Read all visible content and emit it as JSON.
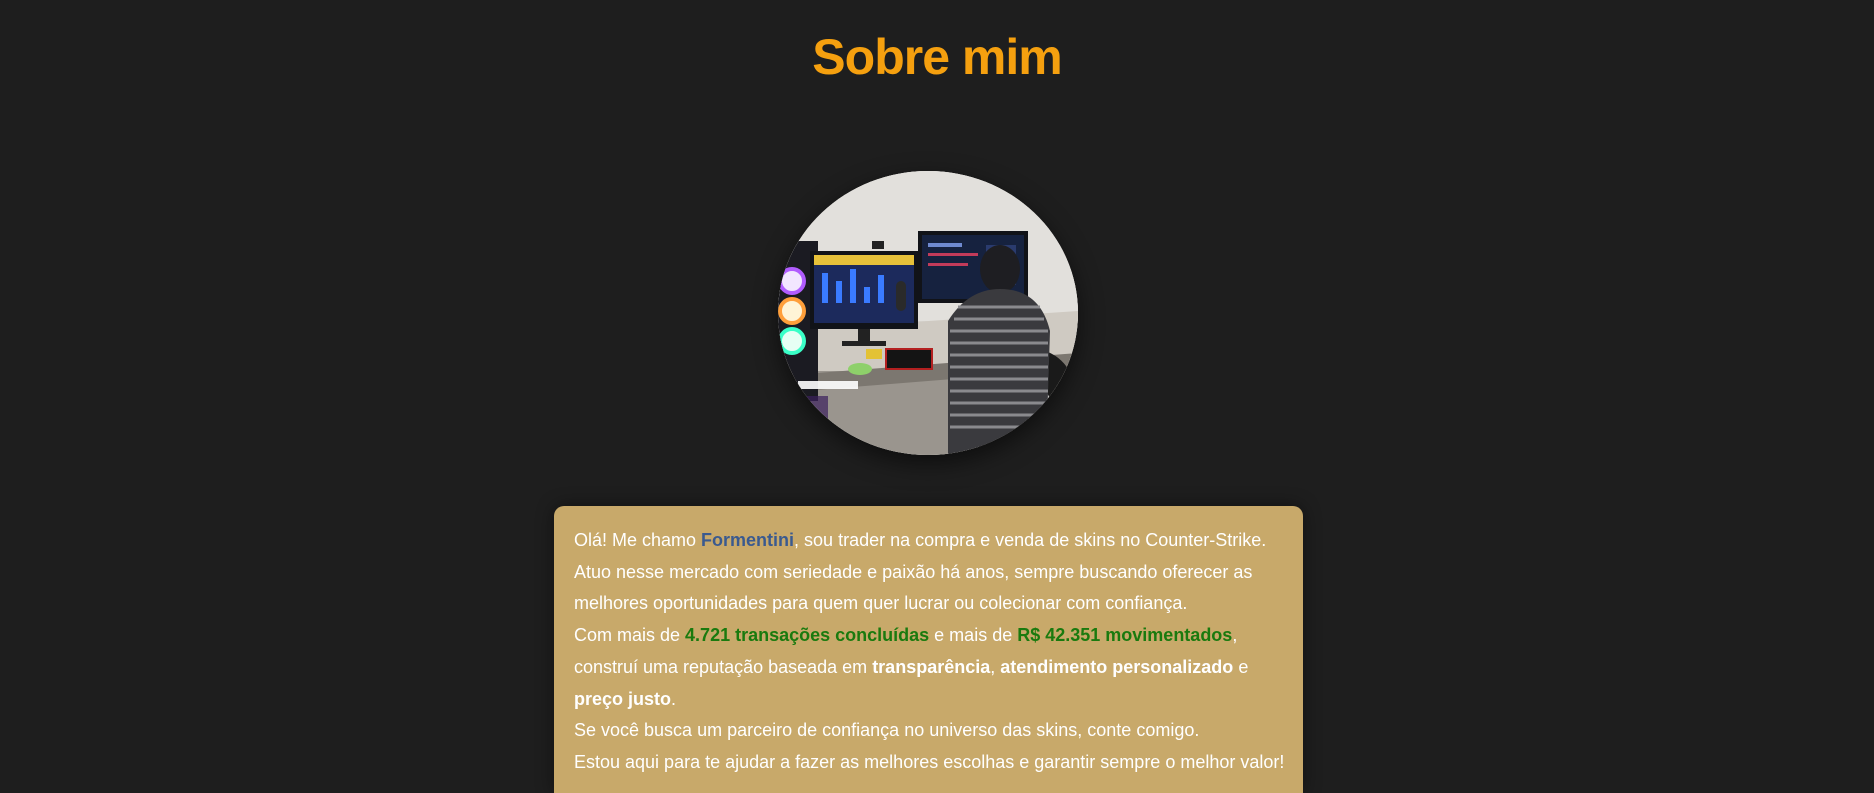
{
  "header": {
    "title": "Sobre mim"
  },
  "colors": {
    "background": "#1e1e1e",
    "title": "#f5a00f",
    "card": "#c8a96a",
    "name_highlight": "#3a5a8f",
    "stat_highlight": "#1a7a0e",
    "text": "#ffffff"
  },
  "about": {
    "photo_icon": "profile-photo",
    "line1_before": "Olá! Me chamo ",
    "name": "Formentini",
    "line1_after": ", sou trader na compra e venda de skins no Counter-Strike.",
    "line2": "Atuo nesse mercado com seriedade e paixão há anos, sempre buscando oferecer as",
    "line3": "melhores oportunidades para quem quer lucrar ou colecionar com confiança.",
    "line4_before": "Com mais de ",
    "transactions": "4.721 transações concluídas",
    "line4_middle": " e mais de ",
    "amount": "R$ 42.351 movimentados",
    "line4_after": ",",
    "line5_before": "construí uma reputação baseada em ",
    "value1": "transparência",
    "line5_sep": ", ",
    "value2": "atendimento personalizado",
    "line5_after": " e",
    "value3": "preço justo",
    "line6_after": ".",
    "line7": "Se você busca um parceiro de confiança no universo das skins, conte comigo.",
    "line8": "Estou aqui para te ajudar a fazer as melhores escolhas e garantir sempre o melhor valor!"
  }
}
